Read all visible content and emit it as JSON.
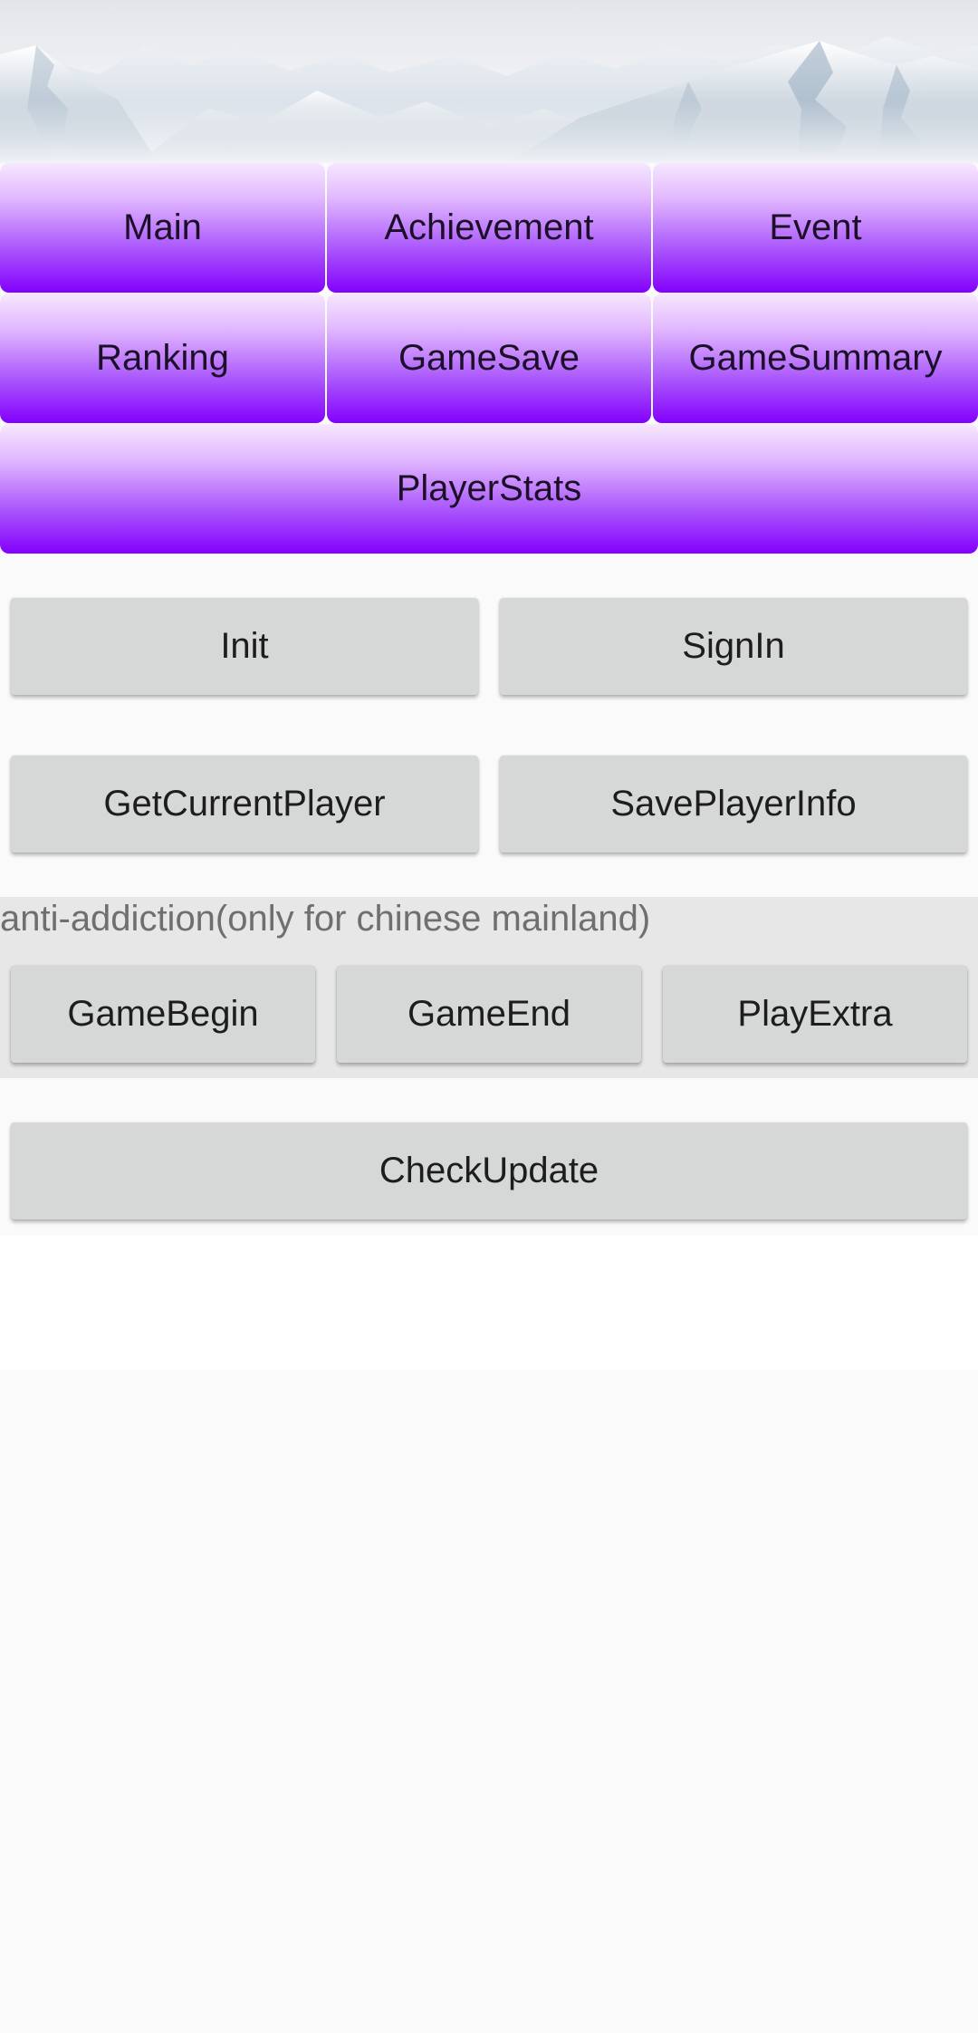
{
  "tabs": {
    "row1": [
      "Main",
      "Achievement",
      "Event"
    ],
    "row2": [
      "Ranking",
      "GameSave",
      "GameSummary"
    ],
    "row3": [
      "PlayerStats"
    ]
  },
  "actions": {
    "init": "Init",
    "sign_in": "SignIn",
    "get_current_player": "GetCurrentPlayer",
    "save_player_info": "SavePlayerInfo"
  },
  "anti_addiction": {
    "label": "anti-addiction(only for chinese mainland)",
    "game_begin": "GameBegin",
    "game_end": "GameEnd",
    "play_extra": "PlayExtra"
  },
  "update": {
    "check_update": "CheckUpdate"
  },
  "colors": {
    "tab_gradient_top": "#f7e7ff",
    "tab_gradient_bottom": "#8300fd",
    "button_grey": "#d6d7d7",
    "section_grey": "#e7e7e7",
    "background": "#fafafa"
  }
}
